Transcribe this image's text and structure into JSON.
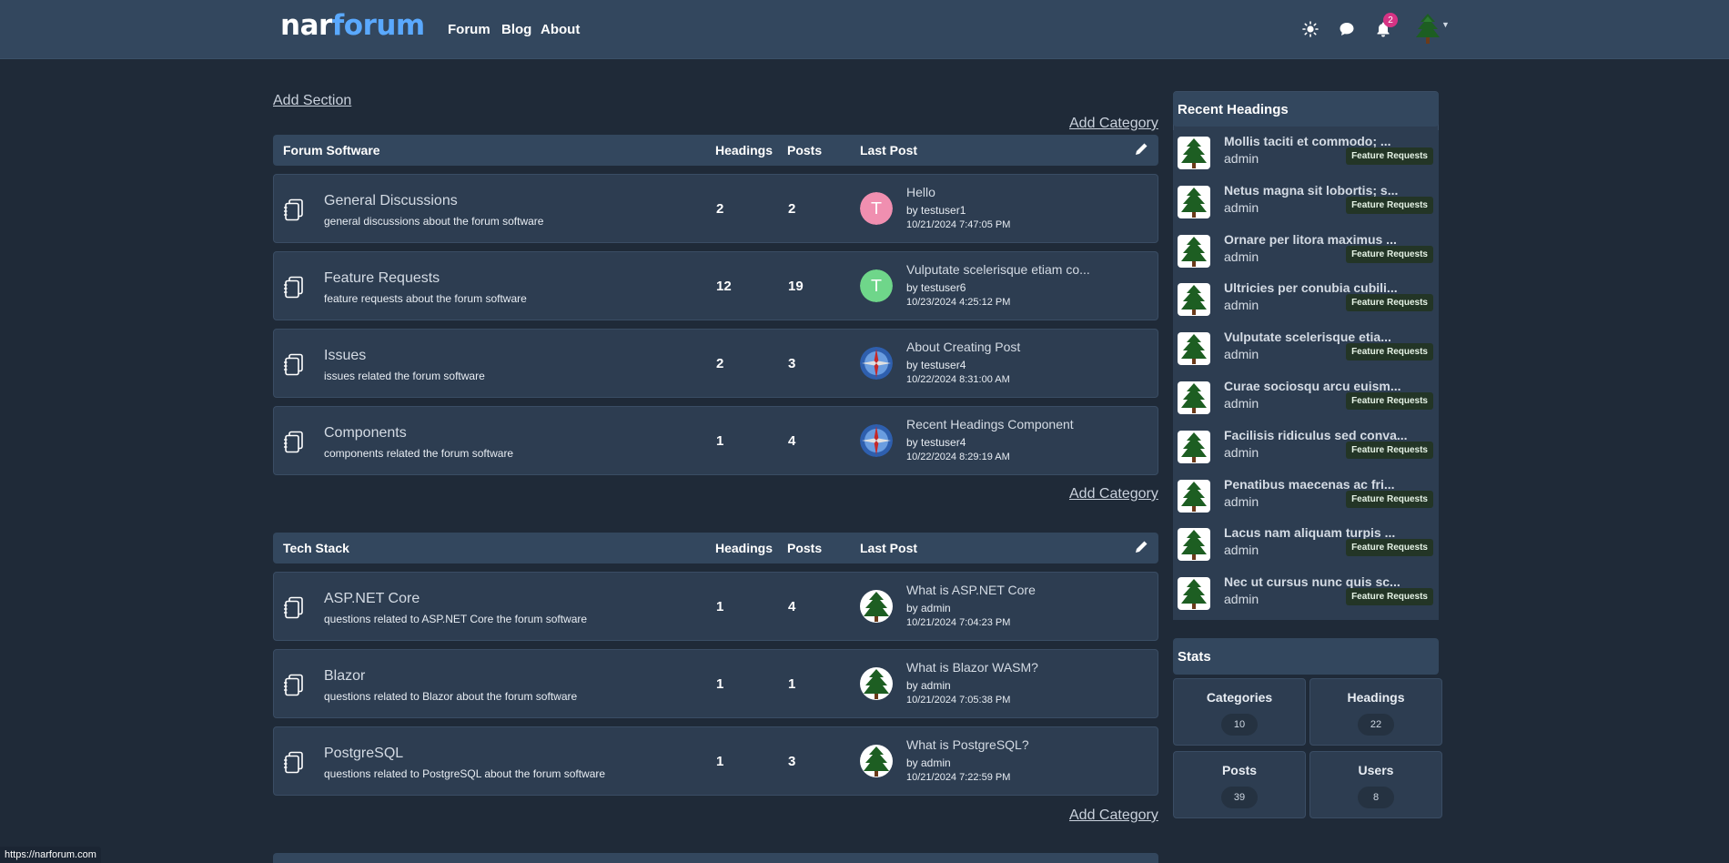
{
  "nav": {
    "brand_part1": "nar",
    "brand_part2": "forum",
    "links": [
      "Forum",
      "Blog",
      "About"
    ],
    "notification_count": "2",
    "icons": [
      "sun-icon",
      "chat-icon",
      "bell-icon",
      "tree-avatar-icon"
    ]
  },
  "add_section": "Add Section",
  "add_category": "Add Category",
  "columns": {
    "headings": "Headings",
    "posts": "Posts",
    "last_post": "Last Post"
  },
  "sections": [
    {
      "title": "Forum Software",
      "categories": [
        {
          "name": "General Discussions",
          "description": "general discussions about the forum software",
          "headings": "2",
          "posts": "2",
          "last_title": "Hello",
          "last_by": "by testuser1",
          "last_date": "10/21/2024 7:47:05 PM",
          "avatar_letter": "T",
          "avatar_color": "#f08fb0"
        },
        {
          "name": "Feature Requests",
          "description": "feature requests about the forum software",
          "headings": "12",
          "posts": "19",
          "last_title": "Vulputate scelerisque etiam co...",
          "last_by": "by testuser6",
          "last_date": "10/23/2024 4:25:12 PM",
          "avatar_letter": "T",
          "avatar_color": "#6fd68a"
        },
        {
          "name": "Issues",
          "description": "issues related the forum software",
          "headings": "2",
          "posts": "3",
          "last_title": "About Creating Post",
          "last_by": "by testuser4",
          "last_date": "10/22/2024 8:31:00 AM",
          "avatar_type": "compass"
        },
        {
          "name": "Components",
          "description": "components related the forum software",
          "headings": "1",
          "posts": "4",
          "last_title": "Recent Headings Component",
          "last_by": "by testuser4",
          "last_date": "10/22/2024 8:29:19 AM",
          "avatar_type": "compass"
        }
      ]
    },
    {
      "title": "Tech Stack",
      "categories": [
        {
          "name": "ASP.NET Core",
          "description": "questions related to ASP.NET Core the forum software",
          "headings": "1",
          "posts": "4",
          "last_title": "What is ASP.NET Core",
          "last_by": "by admin",
          "last_date": "10/21/2024 7:04:23 PM",
          "avatar_type": "tree"
        },
        {
          "name": "Blazor",
          "description": "questions related to Blazor about the forum software",
          "headings": "1",
          "posts": "1",
          "last_title": "What is Blazor WASM?",
          "last_by": "by admin",
          "last_date": "10/21/2024 7:05:38 PM",
          "avatar_type": "tree"
        },
        {
          "name": "PostgreSQL",
          "description": "questions related to PostgreSQL about the forum software",
          "headings": "1",
          "posts": "3",
          "last_title": "What is PostgreSQL?",
          "last_by": "by admin",
          "last_date": "10/21/2024 7:22:59 PM",
          "avatar_type": "tree"
        }
      ]
    }
  ],
  "recent_headings": {
    "title": "Recent Headings",
    "items": [
      {
        "title": "Mollis taciti et commodo; ...",
        "author": "admin",
        "tag": "Feature Requests"
      },
      {
        "title": "Netus magna sit lobortis; s...",
        "author": "admin",
        "tag": "Feature Requests"
      },
      {
        "title": "Ornare per litora maximus ...",
        "author": "admin",
        "tag": "Feature Requests"
      },
      {
        "title": "Ultricies per conubia cubili...",
        "author": "admin",
        "tag": "Feature Requests"
      },
      {
        "title": "Vulputate scelerisque etia...",
        "author": "admin",
        "tag": "Feature Requests"
      },
      {
        "title": "Curae sociosqu arcu euism...",
        "author": "admin",
        "tag": "Feature Requests"
      },
      {
        "title": "Facilisis ridiculus sed conva...",
        "author": "admin",
        "tag": "Feature Requests"
      },
      {
        "title": "Penatibus maecenas ac fri...",
        "author": "admin",
        "tag": "Feature Requests"
      },
      {
        "title": "Lacus nam aliquam turpis ...",
        "author": "admin",
        "tag": "Feature Requests"
      },
      {
        "title": "Nec ut cursus nunc quis sc...",
        "author": "admin",
        "tag": "Feature Requests"
      }
    ]
  },
  "stats": {
    "title": "Stats",
    "items": [
      {
        "label": "Categories",
        "value": "10"
      },
      {
        "label": "Headings",
        "value": "22"
      },
      {
        "label": "Posts",
        "value": "39"
      },
      {
        "label": "Users",
        "value": "8"
      }
    ]
  },
  "status_url": "https://narforum.com",
  "colors": {
    "accent": "#5aa9ff",
    "page_bg": "#1f2a38",
    "header_bg": "#33475e",
    "row_bg": "#2d3d51",
    "badge": "#d63384",
    "tag_bg": "#233526"
  }
}
